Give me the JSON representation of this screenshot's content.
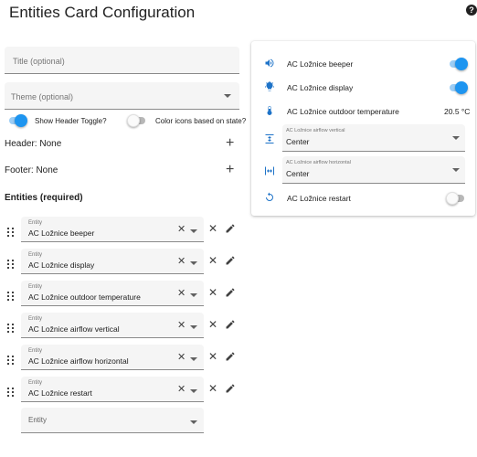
{
  "header": {
    "title": "Entities Card Configuration",
    "help_glyph": "?"
  },
  "form": {
    "title_placeholder": "Title (optional)",
    "theme_placeholder": "Theme (optional)",
    "show_header_toggle_label": "Show Header Toggle?",
    "show_header_toggle_on": true,
    "color_icons_label": "Color icons based on state?",
    "color_icons_on": false,
    "header_label": "Header: None",
    "footer_label": "Footer: None",
    "add_glyph": "+"
  },
  "entities_section": {
    "title": "Entities (required)",
    "field_label": "Entity",
    "clear_glyph": "✕",
    "remove_glyph": "✕",
    "items": [
      "AC Ložnice beeper",
      "AC Ložnice display",
      "AC Ložnice outdoor temperature",
      "AC Ložnice airflow vertical",
      "AC Ložnice airflow horizontal",
      "AC Ložnice restart"
    ],
    "new_entity_placeholder": "Entity"
  },
  "preview": {
    "beeper": {
      "label": "AC Ložnice beeper",
      "on": true,
      "icon": "volume-icon"
    },
    "display": {
      "label": "AC Ložnice display",
      "on": true,
      "icon": "lightbulb-icon"
    },
    "outdoor_temp": {
      "label": "AC Ložnice outdoor temperature",
      "value": "20.5 °C",
      "icon": "thermometer-icon"
    },
    "airflow_vertical": {
      "label": "AC Ložnice airflow vertical",
      "value": "Center",
      "icon": "vertical-arrows-icon"
    },
    "airflow_horizontal": {
      "label": "AC Ložnice airflow horizontal",
      "value": "Center",
      "icon": "horizontal-arrows-icon"
    },
    "restart": {
      "label": "AC Ložnice restart",
      "on": false,
      "icon": "restart-icon"
    }
  },
  "colors": {
    "accent": "#1e95f0",
    "icon": "#1e73c8"
  }
}
